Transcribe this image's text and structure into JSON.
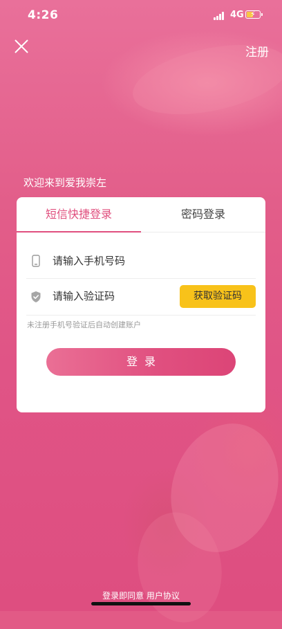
{
  "status_bar": {
    "time": "4:26",
    "network": "4G",
    "battery_color": "#f7c744"
  },
  "header": {
    "close_icon": "close-x-icon",
    "register_label": "注册"
  },
  "welcome_text": "欢迎来到爱我崇左",
  "login_card": {
    "tabs": [
      {
        "label": "短信快捷登录",
        "active": true
      },
      {
        "label": "密码登录",
        "active": false
      }
    ],
    "phone": {
      "icon": "phone-icon",
      "placeholder": "请输入手机号码",
      "value": ""
    },
    "code": {
      "icon": "shield-check-icon",
      "placeholder": "请输入验证码",
      "value": "",
      "get_code_label": "获取验证码"
    },
    "hint": "未注册手机号验证后自动创建账户",
    "login_label": "登录"
  },
  "footer": {
    "agreement_prefix": "登录即同意",
    "agreement_link": "用户协议"
  },
  "colors": {
    "accent": "#e04f7e",
    "button_yellow": "#f8c21a",
    "background": "#e25a86"
  }
}
